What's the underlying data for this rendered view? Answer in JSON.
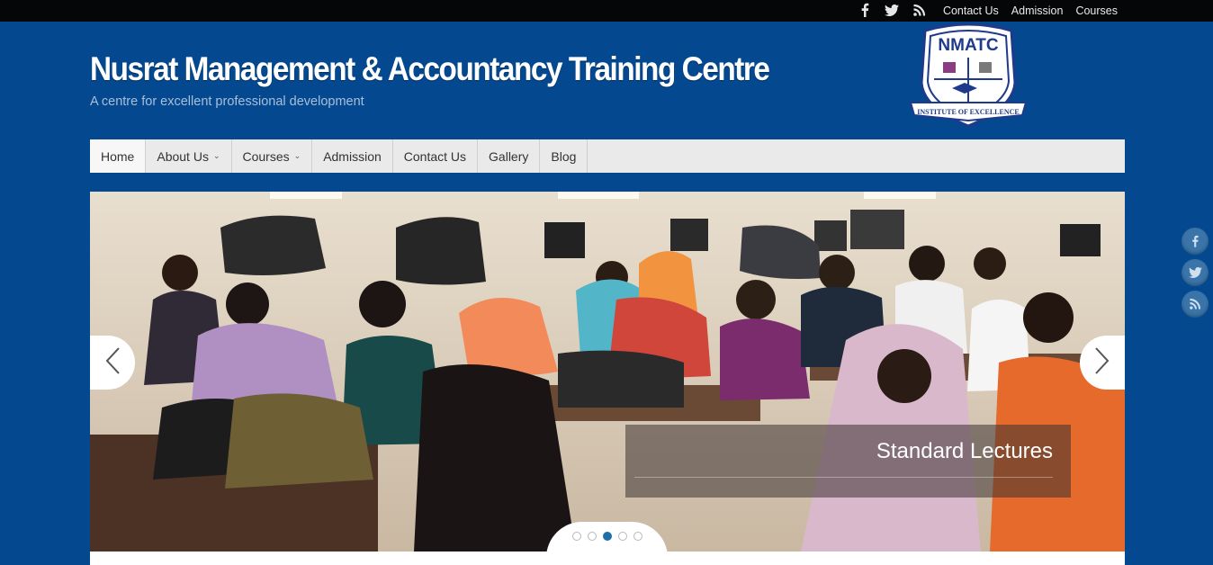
{
  "topbar": {
    "social": [
      {
        "name": "facebook-icon"
      },
      {
        "name": "twitter-icon"
      },
      {
        "name": "rss-icon"
      }
    ],
    "links": [
      "Contact Us",
      "Admission",
      "Courses"
    ]
  },
  "header": {
    "title": "Nusrat Management & Accountancy Training Centre",
    "tagline": "A centre for excellent professional development",
    "logo": {
      "text": "NMATC",
      "motto": "INSTITUTE OF EXCELLENCE"
    }
  },
  "nav": {
    "items": [
      {
        "label": "Home",
        "active": true,
        "dropdown": false
      },
      {
        "label": "About Us",
        "active": false,
        "dropdown": true
      },
      {
        "label": "Courses",
        "active": false,
        "dropdown": true
      },
      {
        "label": "Admission",
        "active": false,
        "dropdown": false
      },
      {
        "label": "Contact Us",
        "active": false,
        "dropdown": false
      },
      {
        "label": "Gallery",
        "active": false,
        "dropdown": false
      },
      {
        "label": "Blog",
        "active": false,
        "dropdown": false
      }
    ]
  },
  "slider": {
    "caption": "Standard Lectures",
    "slide_count": 5,
    "active_slide": 3,
    "prev_icon": "chevron-left-icon",
    "next_icon": "chevron-right-icon"
  },
  "colors": {
    "background": "#04498f",
    "topbar": "#050608",
    "nav": "#eaeaea",
    "pager_active": "#1e6fa8"
  },
  "float_social": [
    "facebook-icon",
    "twitter-icon",
    "rss-icon"
  ]
}
